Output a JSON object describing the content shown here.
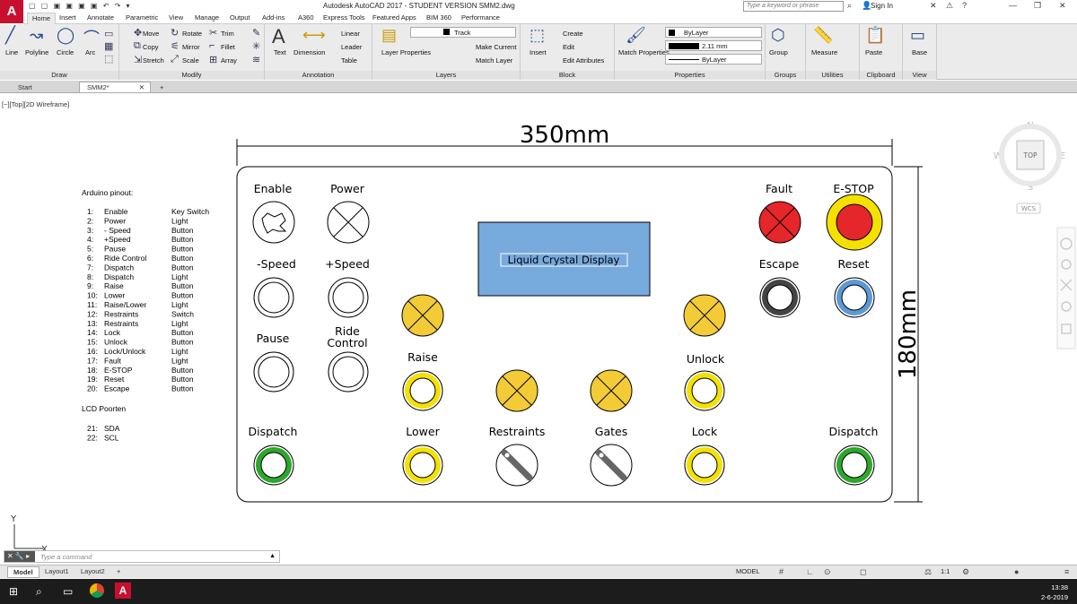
{
  "window": {
    "app_logo": "A",
    "title": "Autodesk AutoCAD 2017 - STUDENT VERSION    SMM2.dwg",
    "search_placeholder": "Type a keyword or phrase",
    "sign_in": "Sign In"
  },
  "ribbon_tabs": [
    "Home",
    "Insert",
    "Annotate",
    "Parametric",
    "View",
    "Manage",
    "Output",
    "Add-ins",
    "A360",
    "Express Tools",
    "Featured Apps",
    "BIM 360",
    "Performance"
  ],
  "ribbon": {
    "draw": {
      "label": "Draw",
      "items": [
        "Line",
        "Polyline",
        "Circle",
        "Arc"
      ]
    },
    "modify": {
      "label": "Modify",
      "items": [
        "Move",
        "Rotate",
        "Trim",
        "Copy",
        "Mirror",
        "Fillet",
        "Stretch",
        "Scale",
        "Array"
      ]
    },
    "annotation": {
      "label": "Annotation",
      "items": [
        "Text",
        "Dimension",
        "Linear",
        "Leader",
        "Table"
      ]
    },
    "layers": {
      "label": "Layers",
      "items": [
        "Layer Properties",
        "Make Current",
        "Match Layer"
      ],
      "current_layer": "Track"
    },
    "block": {
      "label": "Block",
      "items": [
        "Insert",
        "Create",
        "Edit",
        "Edit Attributes"
      ]
    },
    "properties": {
      "label": "Properties",
      "items": [
        "Match Properties"
      ],
      "color": "ByLayer",
      "lineweight": "2.11 mm",
      "linetype": "ByLayer"
    },
    "groups": {
      "label": "Groups",
      "items": [
        "Group"
      ]
    },
    "utilities": {
      "label": "Utilities",
      "items": [
        "Measure"
      ]
    },
    "clipboard": {
      "label": "Clipboard",
      "items": [
        "Paste"
      ]
    },
    "view": {
      "label": "View",
      "items": [
        "Base"
      ]
    }
  },
  "doc_tabs": [
    "Start",
    "SMM2*"
  ],
  "viewport_label": "[−][Top][2D Wireframe]",
  "viewcube": {
    "n": "N",
    "s": "S",
    "e": "E",
    "w": "W",
    "top": "TOP",
    "wcs": "WCS"
  },
  "drawing": {
    "width_dim": "350mm",
    "height_dim": "180mm",
    "pinout_title": "Arduino pinout:",
    "pinout": [
      [
        "1:",
        "Enable",
        "Key Switch"
      ],
      [
        "2:",
        "Power",
        "Light"
      ],
      [
        "3:",
        "- Speed",
        "Button"
      ],
      [
        "4:",
        "+Speed",
        "Button"
      ],
      [
        "5:",
        "Pause",
        "Button"
      ],
      [
        "6:",
        "Ride Control",
        "Button"
      ],
      [
        "7:",
        "Dispatch",
        "Button"
      ],
      [
        "8:",
        "Dispatch",
        "Light"
      ],
      [
        "9:",
        "Raise",
        "Button"
      ],
      [
        "10:",
        "Lower",
        "Button"
      ],
      [
        "11:",
        "Raise/Lower",
        "Light"
      ],
      [
        "12:",
        "Restraints",
        "Switch"
      ],
      [
        "13:",
        "Restraints",
        "Light"
      ],
      [
        "14:",
        "Lock",
        "Button"
      ],
      [
        "15:",
        "Unlock",
        "Button"
      ],
      [
        "16:",
        "Lock/Unlock",
        "Light"
      ],
      [
        "17:",
        "Fault",
        "Light"
      ],
      [
        "18:",
        "E-STOP",
        "Button"
      ],
      [
        "19:",
        "Reset",
        "Button"
      ],
      [
        "20:",
        "Escape",
        "Button"
      ]
    ],
    "lcd_title": "LCD Poorten",
    "lcd": [
      [
        "21:",
        "SDA"
      ],
      [
        "22:",
        "SCL"
      ]
    ],
    "display_label": "Liquid Crystal Display",
    "labels": {
      "enable": "Enable",
      "power": "Power",
      "minus_speed": "-Speed",
      "plus_speed": "+Speed",
      "pause": "Pause",
      "ride_control": "Ride\nControl",
      "dispatch_left": "Dispatch",
      "raise": "Raise",
      "lower": "Lower",
      "restraints": "Restraints",
      "gates": "Gates",
      "lock": "Lock",
      "unlock": "Unlock",
      "fault": "Fault",
      "estop": "E-STOP",
      "escape": "Escape",
      "reset": "Reset",
      "dispatch_right": "Dispatch"
    },
    "colors": {
      "yellow": "#f5e100",
      "amber": "#f3cb36",
      "green": "#2ba82b",
      "red": "#e5262a",
      "blue_ring": "#5a9ad6",
      "dark": "#444444",
      "lcd": "#77aadd"
    }
  },
  "ucs": {
    "y": "Y",
    "x": "X"
  },
  "command": {
    "placeholder": "Type  a  command"
  },
  "layout_tabs": [
    "Model",
    "Layout1",
    "Layout2"
  ],
  "status": {
    "model": "MODEL",
    "scale": "1:1"
  },
  "clock": {
    "time": "13:38",
    "date": "2-6-2019"
  }
}
